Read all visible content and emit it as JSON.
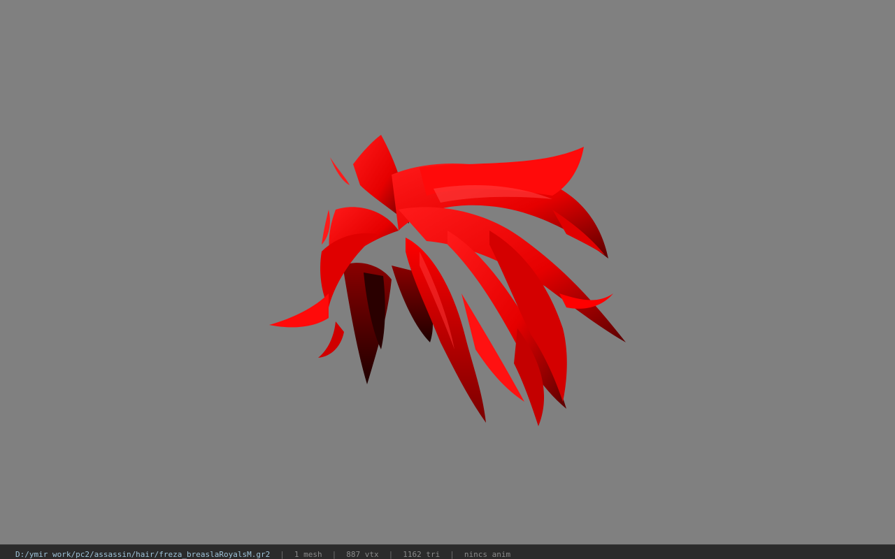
{
  "viewport": {
    "background": "#808080",
    "model_color": "#ff0000",
    "model_shadow": "#3a0000"
  },
  "status": {
    "file_path": "D:/ymir work/pc2/assassin/hair/freza_breaslaRoyalsM.gr2",
    "separator": "|",
    "meshes": "1 mesh",
    "vertices": "887 vtx",
    "triangles": "1162 tri",
    "animation": "nincs anim"
  }
}
